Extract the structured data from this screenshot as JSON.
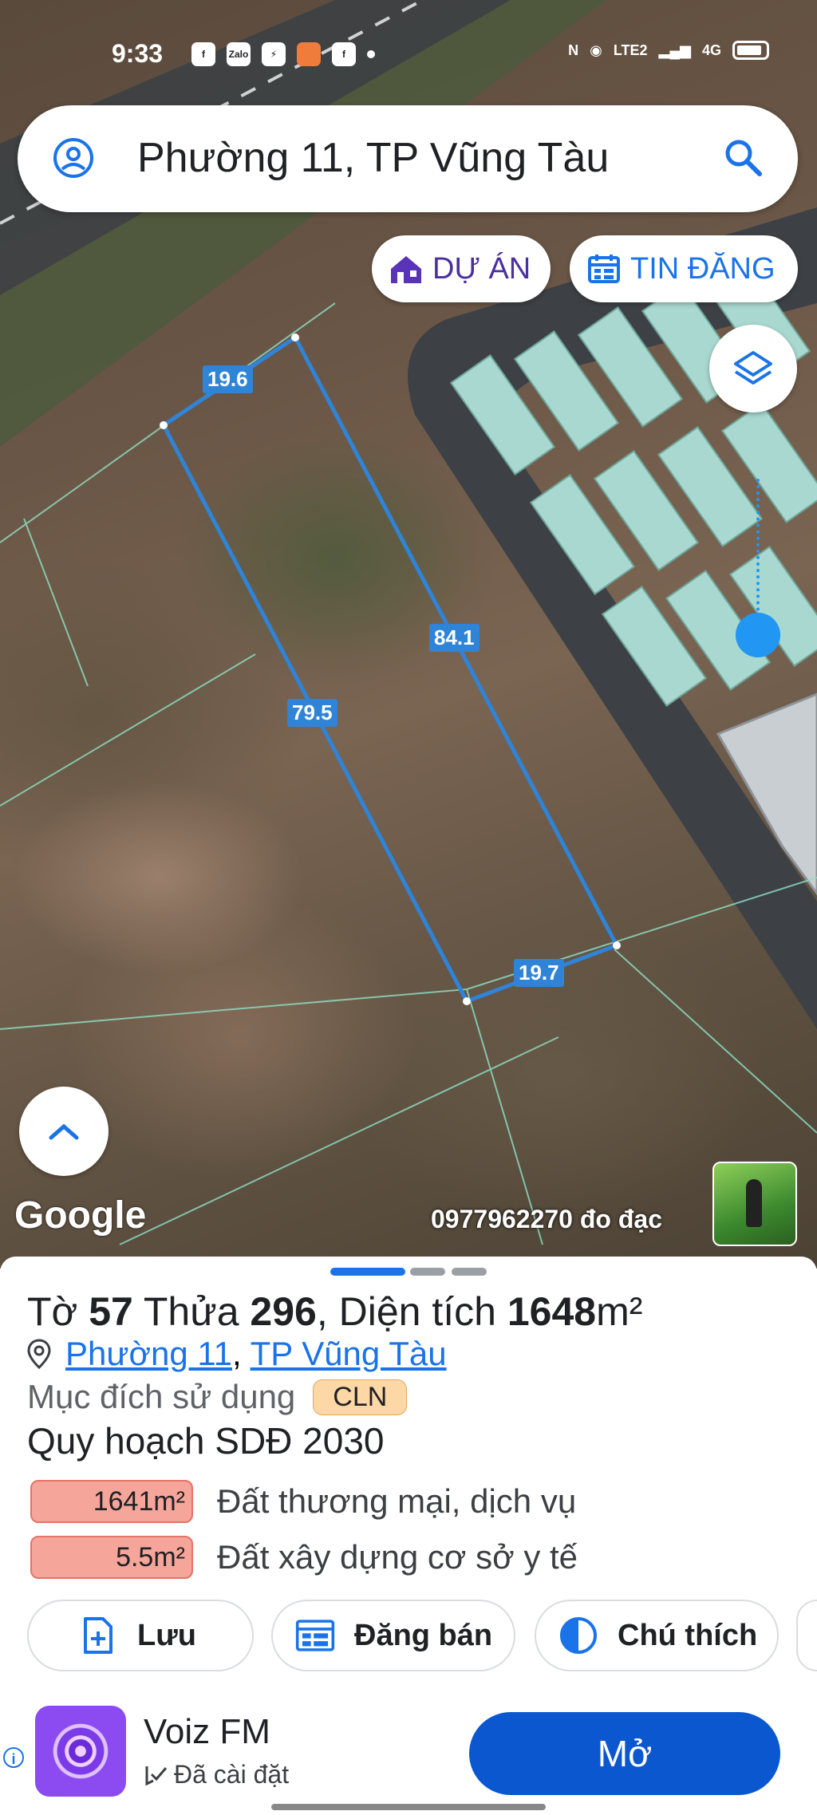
{
  "status_bar": {
    "time": "9:33",
    "left_icons": [
      "facebook-icon",
      "zalo-icon",
      "messenger-icon",
      "photo-app-icon",
      "facebook-icon",
      "dot-icon"
    ],
    "zalo_label": "Zalo",
    "network_label": "4G",
    "lte_label": "LTE2"
  },
  "search": {
    "text": "Phường 11, TP Vũng Tàu"
  },
  "map_buttons": {
    "project_label": "DỰ ÁN",
    "listing_label": "TIN ĐĂNG"
  },
  "plot": {
    "edges": [
      "19.6",
      "84.1",
      "79.5",
      "19.7"
    ],
    "edge_color": "#2f84d8"
  },
  "map_footer": {
    "google_logo": "Google",
    "phone_label": "0977962270 đo đạc"
  },
  "parcel": {
    "sheet_label": "Tờ",
    "sheet_no": "57",
    "plot_label": "Thửa",
    "plot_no": "296",
    "area_label": ", Diện tích",
    "area_value": "1648",
    "area_unit": "m²",
    "ward": "Phường 11",
    "separator": ",",
    "city": "TP Vũng Tàu",
    "use_label": "Mục đích sử dụng",
    "use_code": "CLN",
    "plan_title": "Quy hoạch SDĐ 2030",
    "plan_items": [
      {
        "area": "1641m²",
        "label": "Đất thương mại, dịch vụ"
      },
      {
        "area": "5.5m²",
        "label": "Đất xây dựng cơ sở y tế"
      }
    ]
  },
  "actions": {
    "save_label": "Lưu",
    "post_label": "Đăng bán",
    "legend_label": "Chú thích"
  },
  "ad": {
    "info_label": "i",
    "title": "Voiz FM",
    "installed": "Đã cài đặt",
    "open_label": "Mở"
  },
  "colors": {
    "accent": "#1a73e8",
    "open_button": "#0b57d0",
    "plan_badge": "#f6a59a",
    "use_badge": "#fdd8a6"
  }
}
